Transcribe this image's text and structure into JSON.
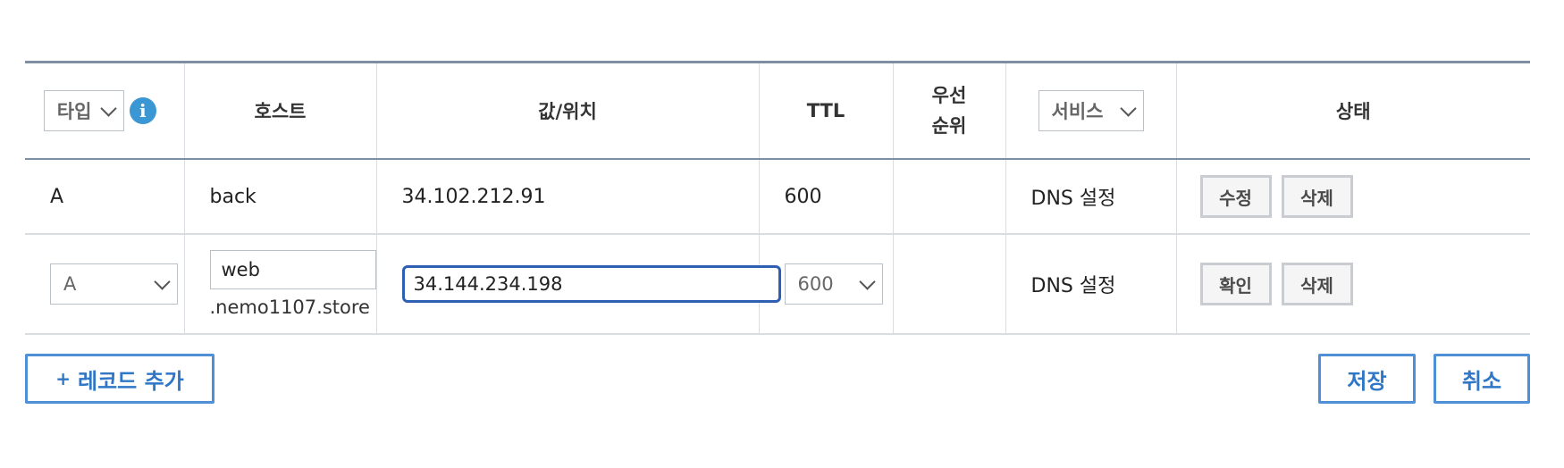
{
  "header": {
    "type_select": "타입",
    "host": "호스트",
    "value": "값/위치",
    "ttl": "TTL",
    "priority_line1": "우선",
    "priority_line2": "순위",
    "service_select": "서비스",
    "status": "상태"
  },
  "rows": [
    {
      "type": "A",
      "host": "back",
      "value": "34.102.212.91",
      "ttl": "600",
      "priority": "",
      "service": "DNS 설정",
      "buttons": [
        "수정",
        "삭제"
      ]
    },
    {
      "type": "A",
      "host_input": "web",
      "domain": ".nemo1107.store",
      "value_input": "34.144.234.198",
      "ttl": "600",
      "priority": "",
      "service": "DNS 설정",
      "buttons": [
        "확인",
        "삭제"
      ]
    }
  ],
  "actions": {
    "add_plus": "+",
    "add_record": "레코드 추가",
    "save": "저장",
    "cancel": "취소"
  },
  "colors": {
    "accent": "#4f8fd6",
    "focus": "#2f5fb3",
    "info": "#3a97d4",
    "header_rule": "#7f8fa3"
  },
  "icons": {
    "info": "info-icon",
    "chevron": "chevron-down-icon"
  }
}
